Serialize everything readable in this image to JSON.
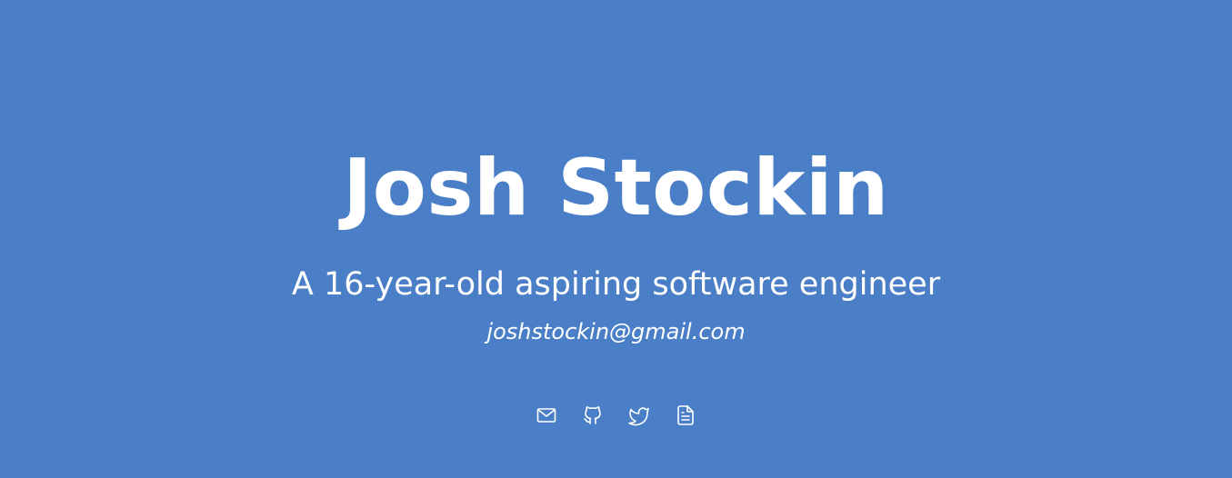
{
  "hero": {
    "name": "Josh Stockin",
    "tagline": "A 16-year-old aspiring software engineer",
    "email": "joshstockin@gmail.com"
  },
  "social_links": [
    {
      "icon": "mail-icon"
    },
    {
      "icon": "github-icon"
    },
    {
      "icon": "twitter-icon"
    },
    {
      "icon": "document-icon"
    }
  ],
  "colors": {
    "background": "#4a7fc7",
    "text": "#ffffff"
  }
}
